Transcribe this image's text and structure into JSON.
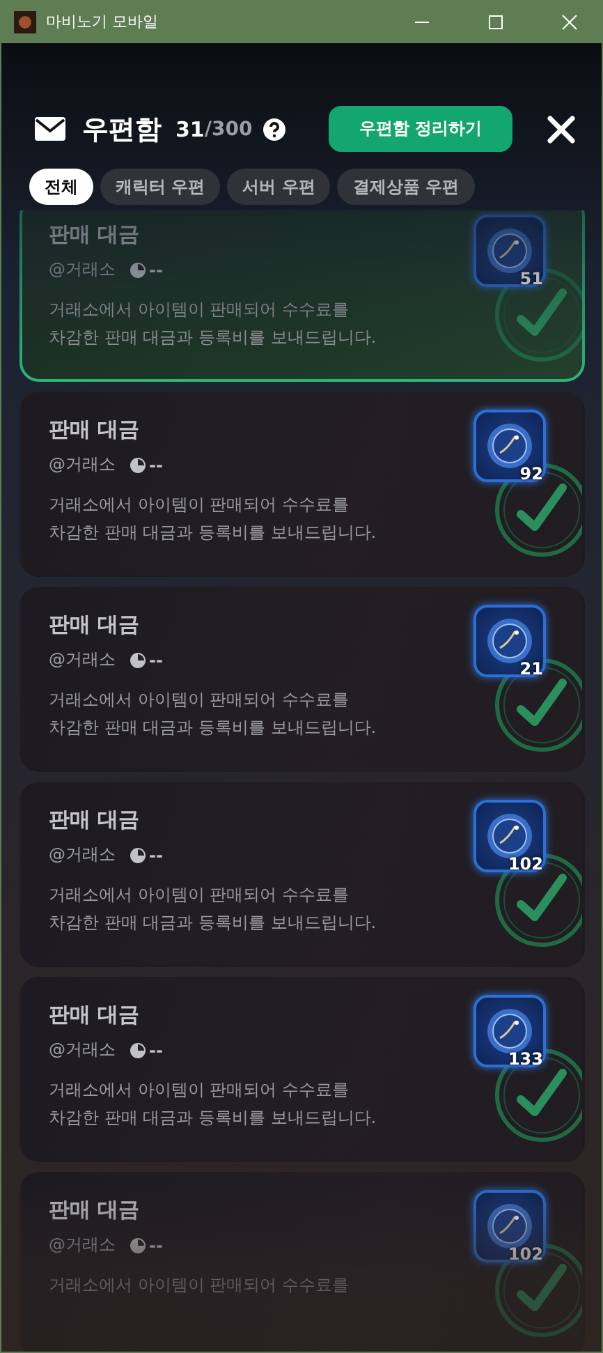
{
  "window": {
    "title": "마비노기 모바일"
  },
  "header": {
    "title": "우편함",
    "count": "31",
    "capacity": "/300",
    "action": "우편함 정리하기"
  },
  "tabs": [
    {
      "label": "전체",
      "selected": true
    },
    {
      "label": "캐릭터 우편",
      "selected": false
    },
    {
      "label": "서버 우편",
      "selected": false
    },
    {
      "label": "결제상품 우편",
      "selected": false
    }
  ],
  "mails": [
    {
      "title": "판매 대금",
      "sender": "@거래소",
      "time": "--",
      "lines": [
        "거래소에서 아이템이 판매되어 수수료를",
        "차감한 판매 대금과 등록비를 보내드립니다."
      ],
      "quantity": "51",
      "selected": true
    },
    {
      "title": "판매 대금",
      "sender": "@거래소",
      "time": "--",
      "lines": [
        "거래소에서 아이템이 판매되어 수수료를",
        "차감한 판매 대금과 등록비를 보내드립니다."
      ],
      "quantity": "92",
      "selected": false
    },
    {
      "title": "판매 대금",
      "sender": "@거래소",
      "time": "--",
      "lines": [
        "거래소에서 아이템이 판매되어 수수료를",
        "차감한 판매 대금과 등록비를 보내드립니다."
      ],
      "quantity": "21",
      "selected": false
    },
    {
      "title": "판매 대금",
      "sender": "@거래소",
      "time": "--",
      "lines": [
        "거래소에서 아이템이 판매되어 수수료를",
        "차감한 판매 대금과 등록비를 보내드립니다."
      ],
      "quantity": "102",
      "selected": false
    },
    {
      "title": "판매 대금",
      "sender": "@거래소",
      "time": "--",
      "lines": [
        "거래소에서 아이템이 판매되어 수수료를",
        "차감한 판매 대금과 등록비를 보내드립니다."
      ],
      "quantity": "133",
      "selected": false
    },
    {
      "title": "판매 대금",
      "sender": "@거래소",
      "time": "--",
      "lines": [
        "거래소에서 아이템이 판매되어 수수료를"
      ],
      "quantity": "102",
      "selected": false
    }
  ]
}
